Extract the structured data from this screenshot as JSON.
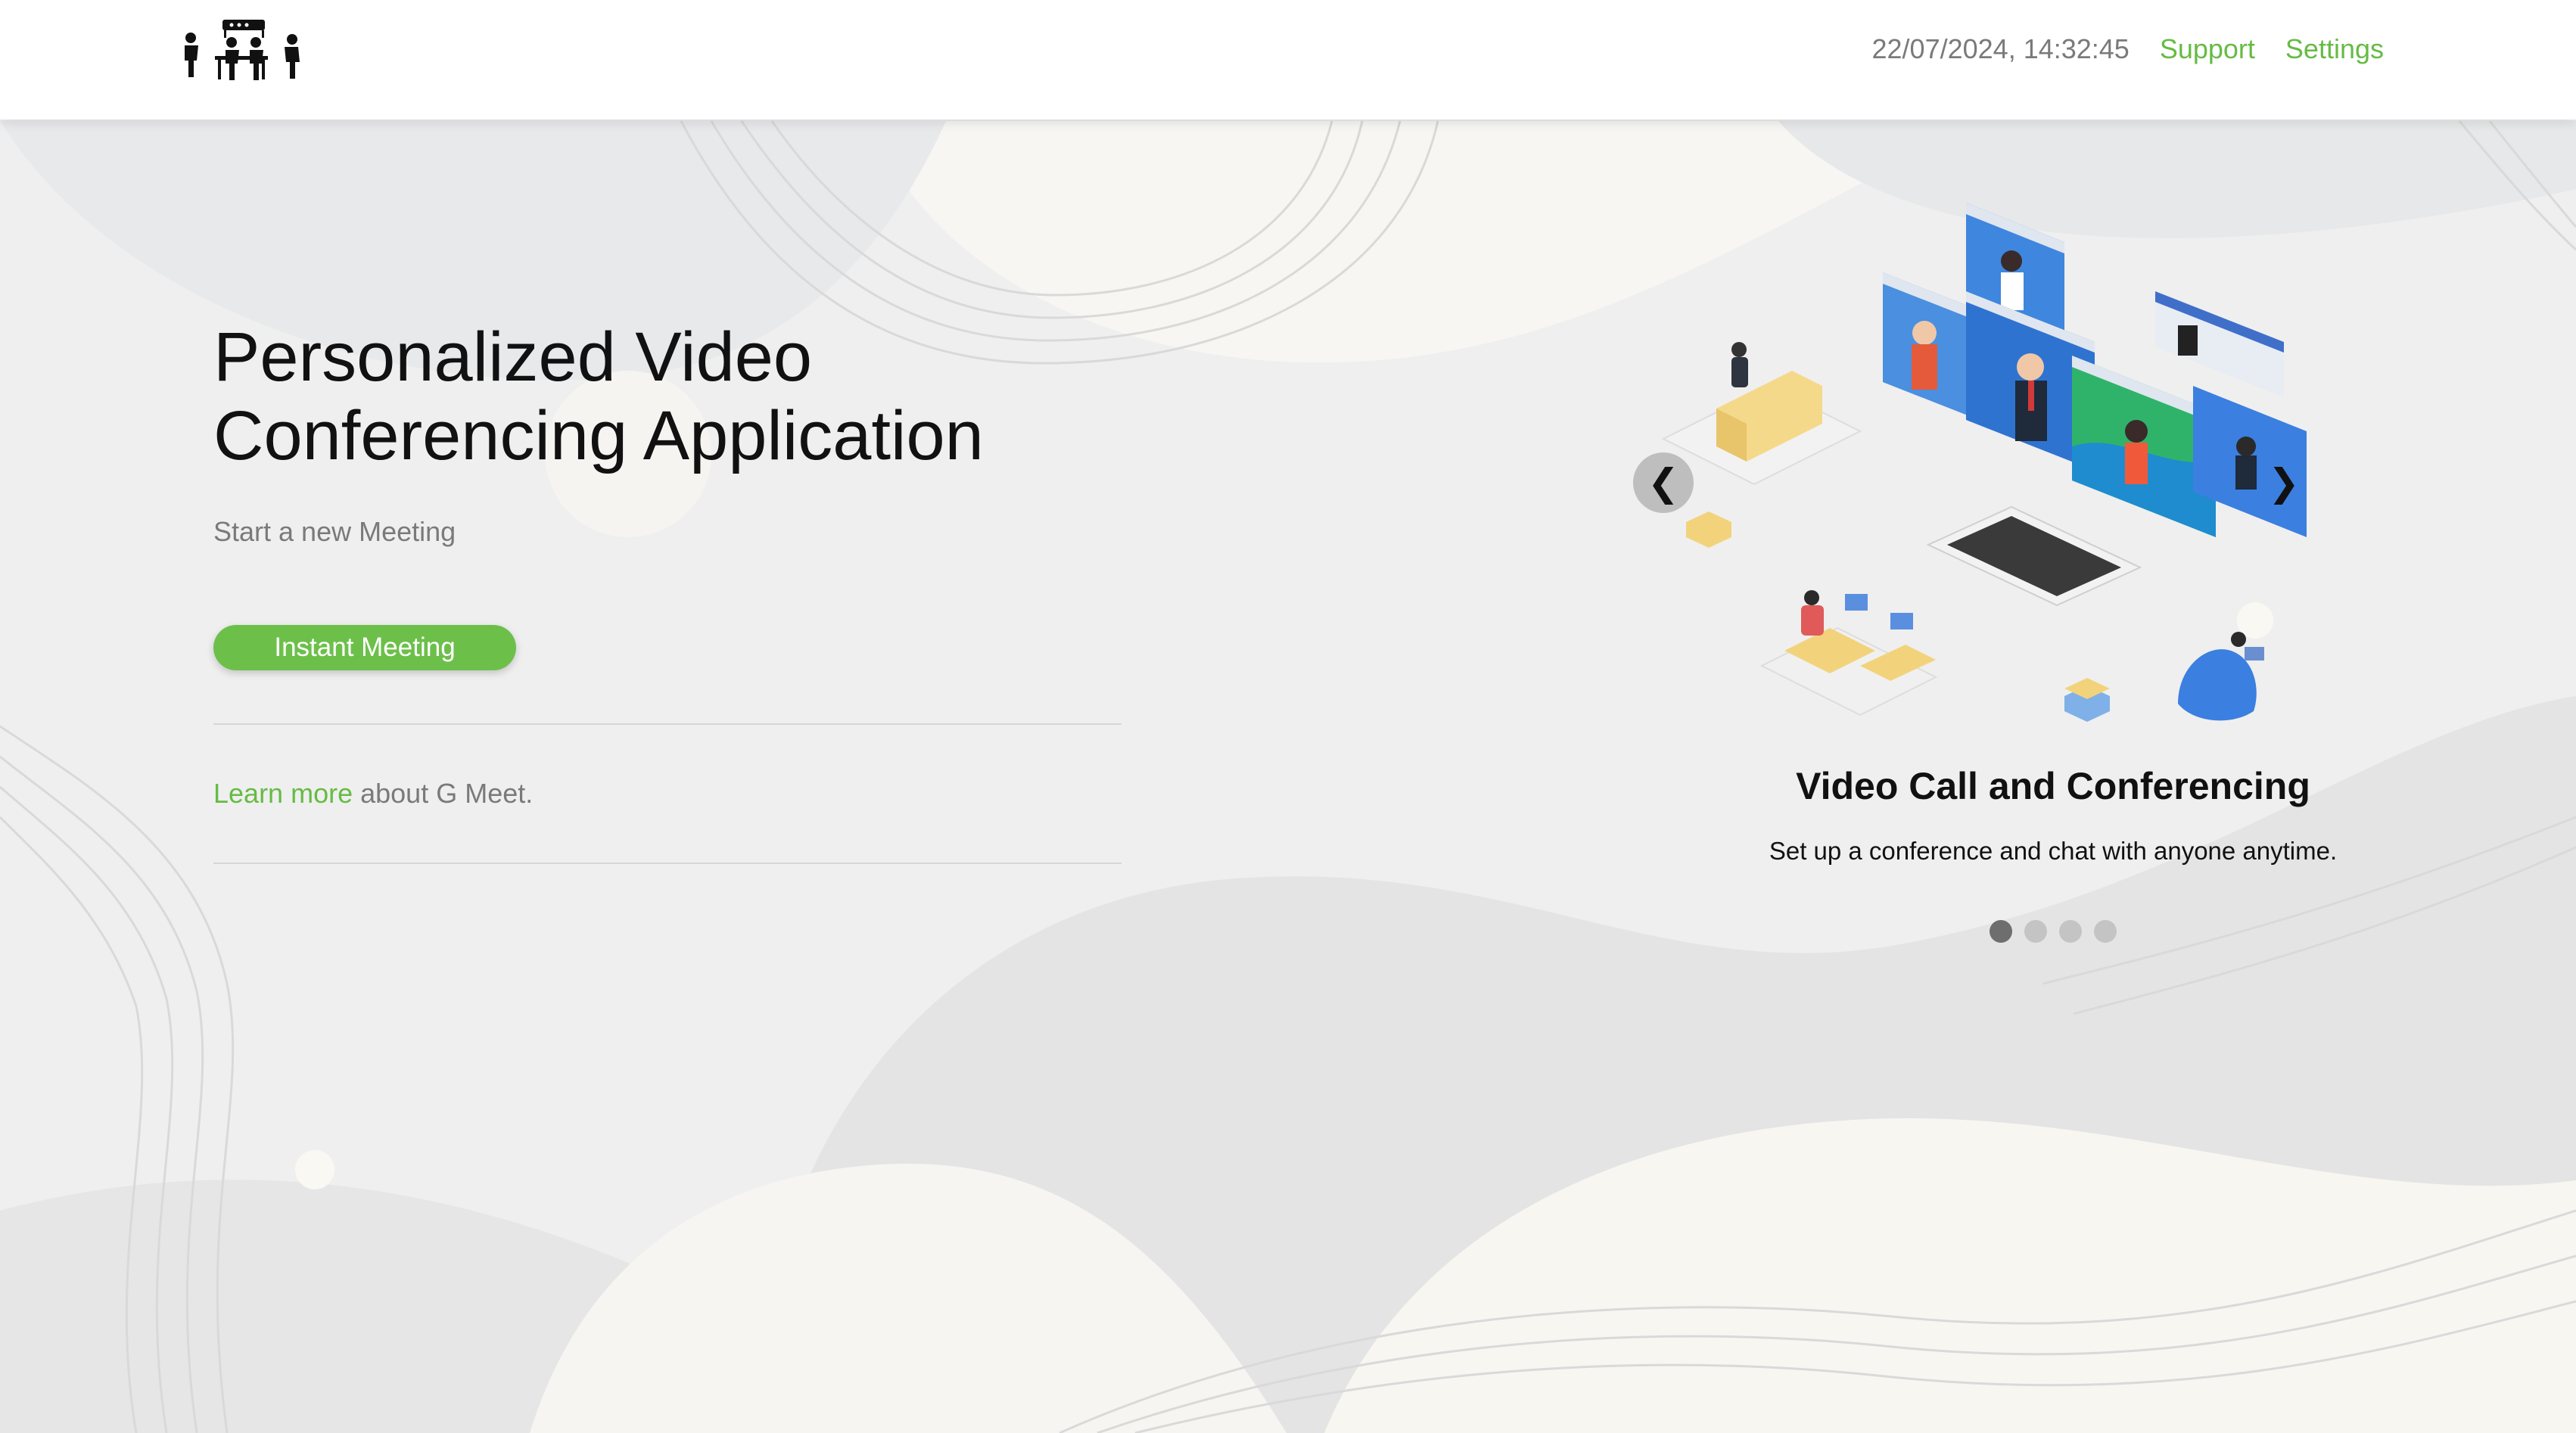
{
  "header": {
    "datetime": "22/07/2024, 14:32:45",
    "support_label": "Support",
    "settings_label": "Settings",
    "logo_icon": "meeting-people-logo-icon"
  },
  "hero": {
    "title": "Personalized Video Conferencing Application",
    "subtitle": "Start a new Meeting",
    "instant_meeting_label": "Instant Meeting",
    "learn_more_link": "Learn more",
    "learn_more_suffix": " about G Meet."
  },
  "carousel": {
    "prev_arrow": "❮",
    "next_arrow": "❯",
    "slide_title": "Video Call and Conferencing",
    "slide_text": "Set up a conference and chat with anyone anytime.",
    "dot_count": 4,
    "active_dot": 1,
    "illustration_icon": "video-conference-illustration"
  },
  "colors": {
    "accent": "#6cc04a",
    "link": "#66bb44",
    "muted_text": "#7a7a7a",
    "header_bg": "#ffffff"
  }
}
